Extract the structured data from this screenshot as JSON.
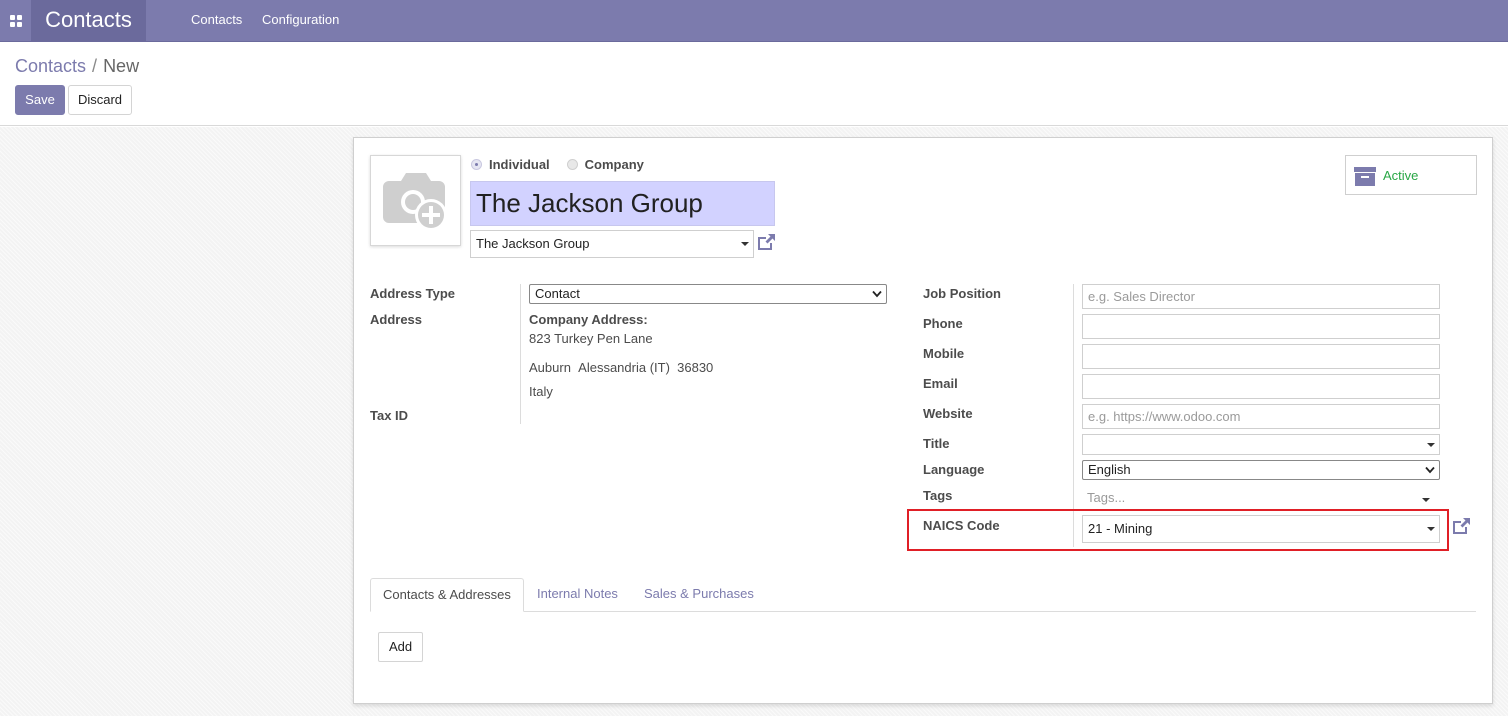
{
  "navbar": {
    "brand": "Contacts",
    "menu": [
      "Contacts",
      "Configuration"
    ]
  },
  "breadcrumb": {
    "parent": "Contacts",
    "separator": "/",
    "current": "New"
  },
  "buttons": {
    "save": "Save",
    "discard": "Discard"
  },
  "form": {
    "type_options": [
      "Individual",
      "Company"
    ],
    "selected_type": "Individual",
    "name": "The Jackson Group",
    "company": "The Jackson Group",
    "active_label": "Active",
    "left": {
      "address_type_label": "Address Type",
      "address_type_value": "Contact",
      "address_label": "Address",
      "company_address_heading": "Company Address:",
      "street": "823 Turkey Pen Lane",
      "city": "Auburn",
      "state": "Alessandria (IT)",
      "zip": "36830",
      "country": "Italy",
      "tax_id_label": "Tax ID"
    },
    "right": {
      "job_position_label": "Job Position",
      "job_position_placeholder": "e.g. Sales Director",
      "phone_label": "Phone",
      "mobile_label": "Mobile",
      "email_label": "Email",
      "website_label": "Website",
      "website_placeholder": "e.g. https://www.odoo.com",
      "title_label": "Title",
      "language_label": "Language",
      "language_value": "English",
      "tags_label": "Tags",
      "tags_placeholder": "Tags...",
      "naics_label": "NAICS Code",
      "naics_value": "21 - Mining"
    },
    "tabs": [
      "Contacts & Addresses",
      "Internal Notes",
      "Sales & Purchases"
    ],
    "active_tab": "Contacts & Addresses",
    "add_label": "Add"
  },
  "colors": {
    "brand": "#7c7bad",
    "highlight": "#e01f26",
    "active": "#28a745",
    "name_bg": "#d2d2ff"
  }
}
